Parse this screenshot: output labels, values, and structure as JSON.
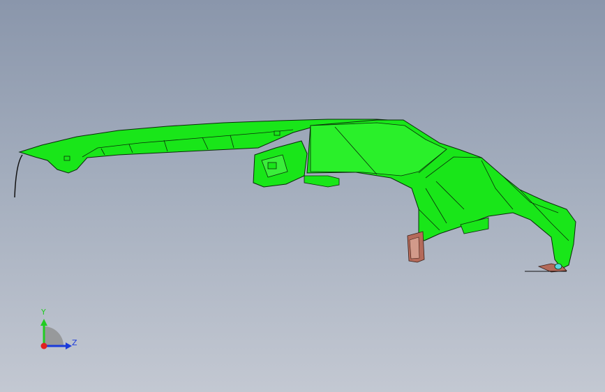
{
  "viewport": {
    "background_top": "#8a96ab",
    "background_bottom": "#c3c8d2"
  },
  "model": {
    "part_color": "#19e619",
    "edge_color": "#0a2a0a",
    "bracket_color": "#b46a5a"
  },
  "triad": {
    "y_label": "Y",
    "z_label": "Z",
    "y_color": "#22cc22",
    "z_color": "#1a3adb",
    "x_color": "#e02020"
  }
}
